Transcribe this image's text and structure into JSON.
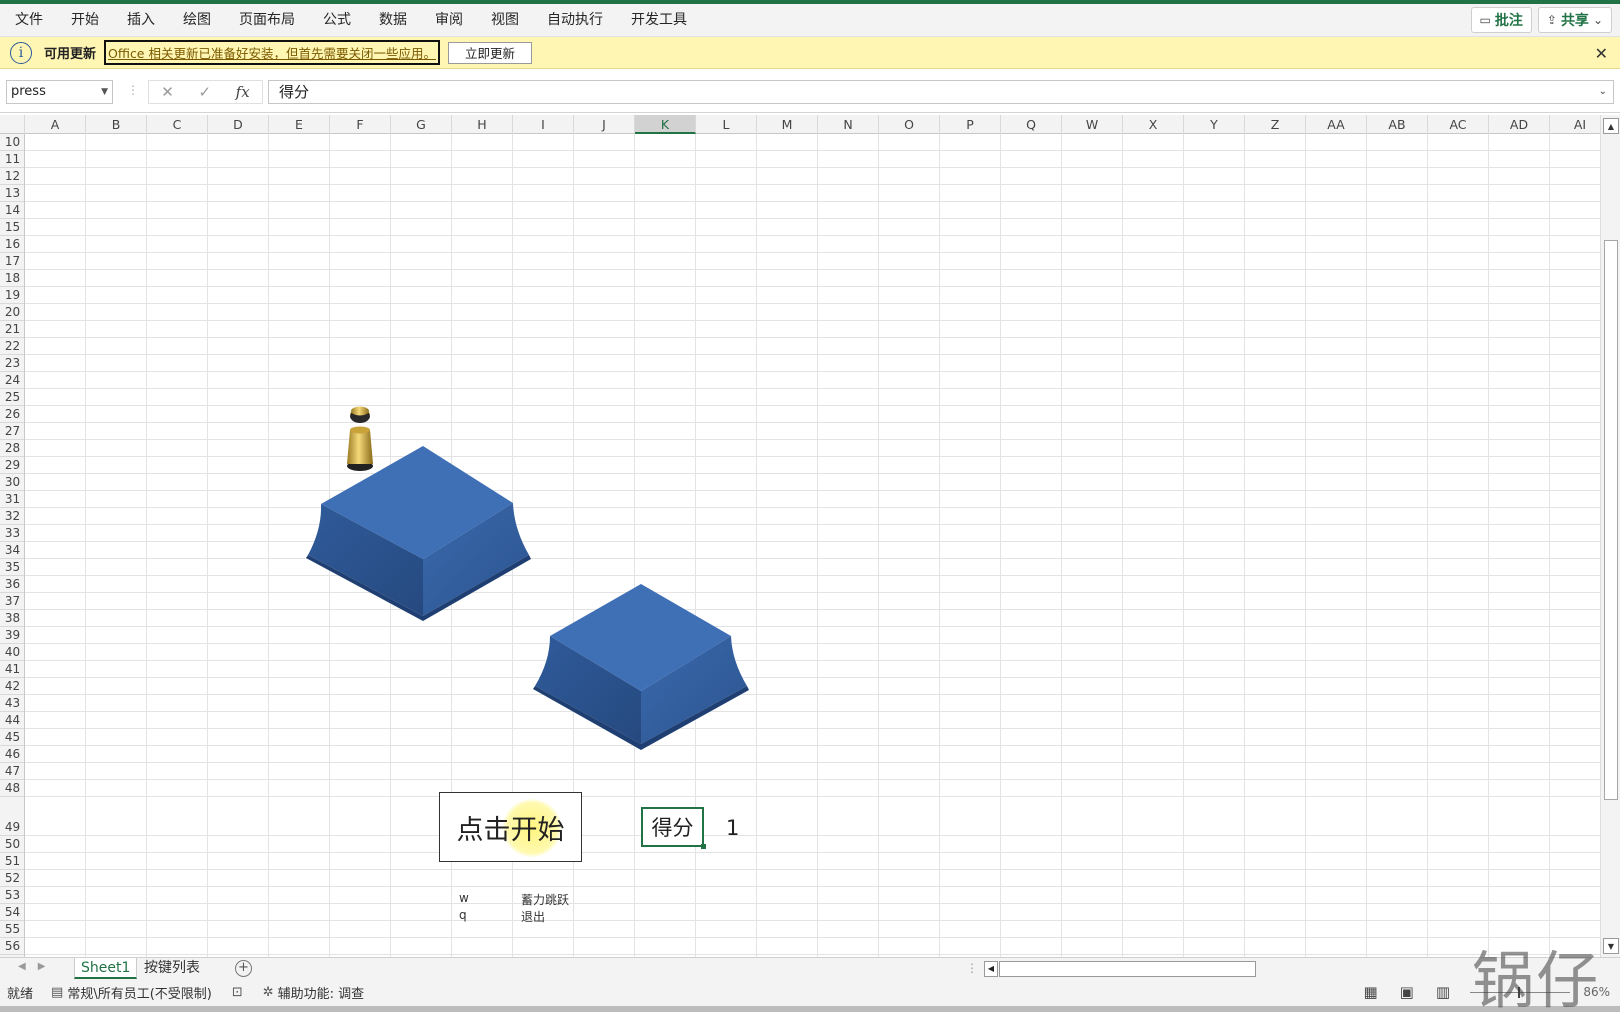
{
  "ribbon": {
    "tabs": [
      "文件",
      "开始",
      "插入",
      "绘图",
      "页面布局",
      "公式",
      "数据",
      "审阅",
      "视图",
      "自动执行",
      "开发工具"
    ],
    "comments_label": "批注",
    "share_label": "共享"
  },
  "message_bar": {
    "title": "可用更新",
    "text": "Office 相关更新已准备好安装，但首先需要关闭一些应用。",
    "button_label": "立即更新"
  },
  "formula_bar": {
    "name_box": "press",
    "cancel_glyph": "✕",
    "enter_glyph": "✓",
    "fx_label": "fx",
    "content": "得分"
  },
  "columns": [
    "A",
    "B",
    "C",
    "D",
    "E",
    "F",
    "G",
    "H",
    "I",
    "J",
    "K",
    "L",
    "M",
    "N",
    "O",
    "P",
    "Q",
    "W",
    "X",
    "Y",
    "Z",
    "AA",
    "AB",
    "AC",
    "AD",
    "AI"
  ],
  "selected_column": "K",
  "rows": [
    "10",
    "11",
    "12",
    "13",
    "14",
    "15",
    "16",
    "17",
    "18",
    "19",
    "20",
    "21",
    "22",
    "23",
    "24",
    "25",
    "26",
    "27",
    "28",
    "29",
    "30",
    "31",
    "32",
    "33",
    "34",
    "35",
    "36",
    "37",
    "38",
    "39",
    "40",
    "41",
    "42",
    "43",
    "44",
    "45",
    "46",
    "47",
    "48",
    "49",
    "50",
    "51",
    "52",
    "53",
    "54",
    "55",
    "56"
  ],
  "game": {
    "start_button": "点击开始",
    "score_label": "得分",
    "score_value": "1",
    "key_list": [
      {
        "key": "w",
        "action": "蓄力跳跃"
      },
      {
        "key": "q",
        "action": "退出"
      }
    ],
    "platform_color": "#3f6fb5",
    "piece_color": "#e6c04a"
  },
  "sheets": {
    "tabs": [
      "Sheet1",
      "按键列表"
    ],
    "active": "Sheet1"
  },
  "status": {
    "ready": "就绪",
    "sensitivity": "常规\\所有员工(不受限制)",
    "accessibility": "辅助功能: 调查",
    "zoom": "86%"
  },
  "watermark": "锅仔"
}
